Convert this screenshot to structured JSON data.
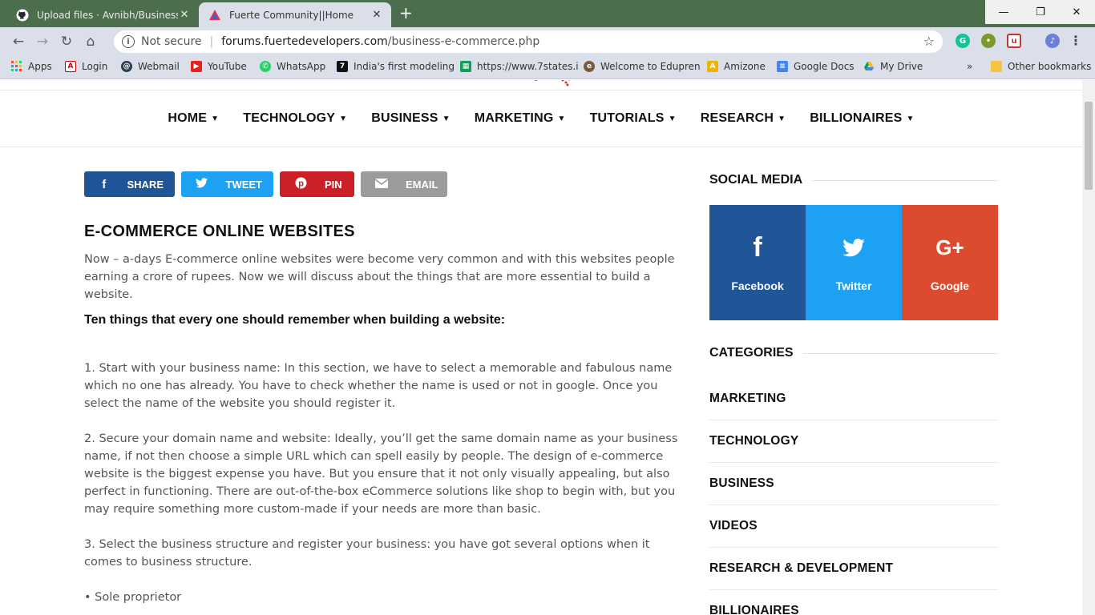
{
  "browser": {
    "tabs": [
      {
        "title": "Upload files · Avnibh/Business-Bl",
        "icon": "github-icon",
        "active": false
      },
      {
        "title": "Fuerte Community||Home",
        "icon": "fuerte-logo-icon",
        "active": true
      }
    ],
    "address": {
      "security": "Not secure",
      "domain": "forums.fuertedevelopers.com",
      "path": "/business-e-commerce.php"
    },
    "bookmarks": [
      {
        "label": "Apps",
        "icon": "apps-grid-icon"
      },
      {
        "label": "Login",
        "icon": "login-icon"
      },
      {
        "label": "Webmail",
        "icon": "webmail-icon"
      },
      {
        "label": "YouTube",
        "icon": "youtube-icon"
      },
      {
        "label": "WhatsApp",
        "icon": "whatsapp-icon"
      },
      {
        "label": "India's first modeling",
        "icon": "seven-icon"
      },
      {
        "label": "https://www.7states.i",
        "icon": "sheets-icon"
      },
      {
        "label": "Welcome to Edupren",
        "icon": "edupren-icon"
      },
      {
        "label": "Amizone",
        "icon": "amizone-icon"
      },
      {
        "label": "Google Docs",
        "icon": "docs-icon"
      },
      {
        "label": "My Drive",
        "icon": "drive-icon"
      }
    ],
    "bookmarks_overflow": "»",
    "other_bookmarks": "Other bookmarks"
  },
  "nav": {
    "items": [
      "HOME",
      "TECHNOLOGY",
      "BUSINESS",
      "MARKETING",
      "TUTORIALS",
      "RESEARCH",
      "BILLIONAIRES"
    ]
  },
  "share": {
    "facebook": "SHARE",
    "twitter": "TWEET",
    "pinterest": "PIN",
    "email": "EMAIL"
  },
  "article": {
    "title": "E-COMMERCE ONLINE WEBSITES",
    "intro": "Now – a-days E-commerce online websites were become very common and with this websites people earning a crore of rupees. Now we will discuss about the things that are more essential to build a website.",
    "subheading": "Ten things that every one should remember when building a website:",
    "point1": "1. Start with your business name: In this section, we have to select a memorable and fabulous name which no one has already. You have to check whether the name is used or not in google. Once you select the name of the website you should register it.",
    "point2": "2. Secure your domain name and website: Ideally, you’ll get the same domain name as your business name, if not then choose a simple URL which can spell easily by people. The design of e-commerce website is the biggest expense you have. But you ensure that it not only visually appealing, but also perfect in functioning. There are out-of-the-box eCommerce solutions like shop to begin with, but you may require something more custom-made if your needs are more than basic.",
    "point3": "3. Select the business structure and register your business: you have got several options when it comes to business structure.",
    "bullet1": "• Sole proprietor"
  },
  "sidebar": {
    "social_title": "SOCIAL MEDIA",
    "social": [
      {
        "label": "Facebook",
        "color": "#205598"
      },
      {
        "label": "Twitter",
        "color": "#1da1f2"
      },
      {
        "label": "Google",
        "color": "#dd4b2e"
      }
    ],
    "categories_title": "CATEGORIES",
    "categories": [
      "MARKETING",
      "TECHNOLOGY",
      "BUSINESS",
      "VIDEOS",
      "RESEARCH & DEVELOPMENT",
      "BILLIONAIRES"
    ]
  }
}
